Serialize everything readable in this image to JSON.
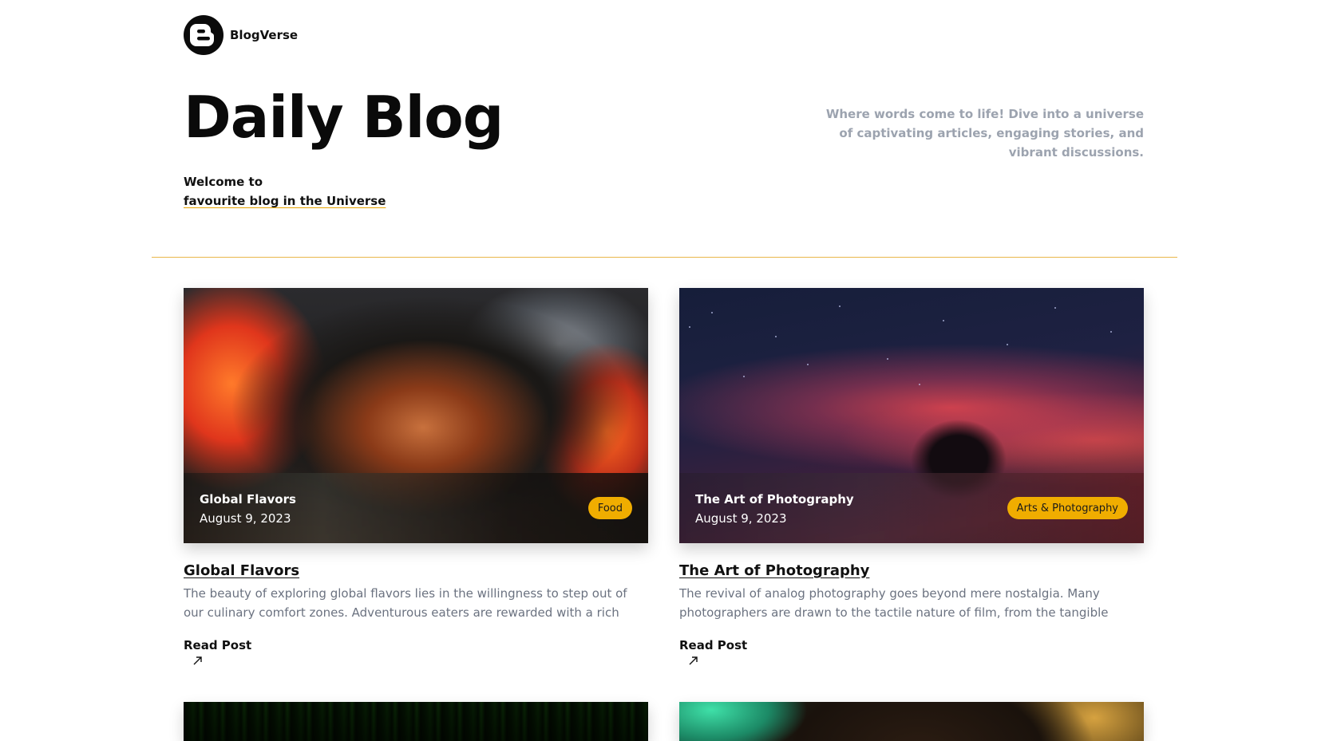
{
  "brand": {
    "name": "BlogVerse",
    "logo_icon": "blogger-b-icon"
  },
  "hero": {
    "title": "Daily Blog",
    "welcome_line1": "Welcome to",
    "welcome_line2": "favourite blog in the Universe",
    "tagline": "Where words come to life! Dive into a universe of captivating articles, engaging stories, and vibrant discussions."
  },
  "colors": {
    "accent": "#f0ad00",
    "divider": "#e9b64a",
    "muted": "#9ca3af"
  },
  "posts": [
    {
      "overlay_title": "Global Flavors",
      "date": "August 9, 2023",
      "category": "Food",
      "title": "Global Flavors",
      "excerpt": "The beauty of exploring global flavors lies in the willingness to step out of our culinary comfort zones. Adventurous eaters are rewarded with a rich mosaic of...",
      "read_label": "Read Post",
      "arrow_icon": "arrow-up-right-icon"
    },
    {
      "overlay_title": "The Art of Photography",
      "date": "August 9, 2023",
      "category": "Arts & Photography",
      "title": "The Art of Photography",
      "excerpt": "The revival of analog photography goes beyond mere nostalgia. Many photographers are drawn to the tactile nature of film, from the tangible weight ...",
      "read_label": "Read Post",
      "arrow_icon": "arrow-up-right-icon"
    }
  ]
}
